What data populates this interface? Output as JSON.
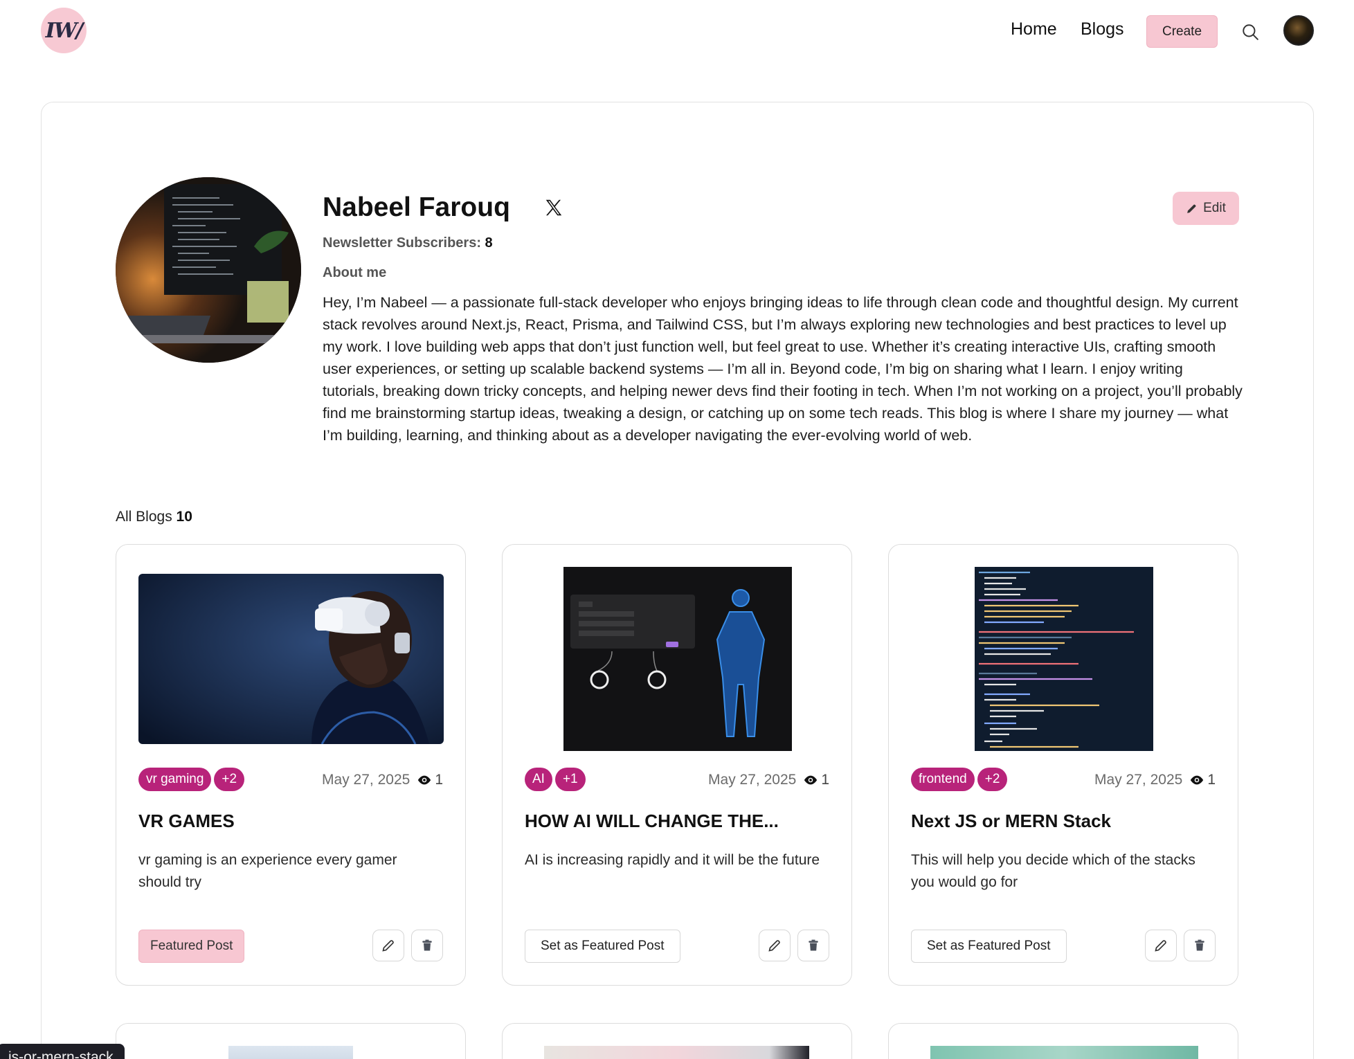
{
  "nav": {
    "logo_text": "IW/",
    "links": [
      "Home",
      "Blogs"
    ],
    "create_label": "Create"
  },
  "profile": {
    "name": "Nabeel Farouq",
    "subscribers_label": "Newsletter Subscribers:",
    "subscribers_count": "8",
    "about_label": "About me",
    "about_text": "Hey, I’m Nabeel — a passionate full-stack developer who enjoys bringing ideas to life through clean code and thoughtful design. My current stack revolves around Next.js, React, Prisma, and Tailwind CSS, but I’m always exploring new technologies and best practices to level up my work. I love building web apps that don’t just function well, but feel great to use. Whether it’s creating interactive UIs, crafting smooth user experiences, or setting up scalable backend systems — I’m all in. Beyond code, I’m big on sharing what I learn. I enjoy writing tutorials, breaking down tricky concepts, and helping newer devs find their footing in tech. When I’m not working on a project, you’ll probably find me brainstorming startup ideas, tweaking a design, or catching up on some tech reads. This blog is where I share my journey — what I’m building, learning, and thinking about as a developer navigating the ever-evolving world of web.",
    "edit_label": "Edit"
  },
  "blogs": {
    "label": "All Blogs",
    "count": "10",
    "cards": [
      {
        "tag": "vr gaming",
        "tag_more": "+2",
        "date": "May 27, 2025",
        "views": "1",
        "title": "VR GAMES",
        "description": "vr gaming is an experience every gamer should try",
        "featured_label": "Featured Post"
      },
      {
        "tag": "AI",
        "tag_more": "+1",
        "date": "May 27, 2025",
        "views": "1",
        "title": "HOW AI WILL CHANGE THE...",
        "description": "AI is increasing rapidly and it will be the future",
        "featured_label": "Set as Featured Post"
      },
      {
        "tag": "frontend",
        "tag_more": "+2",
        "date": "May 27, 2025",
        "views": "1",
        "title": "Next JS or MERN Stack",
        "description": "This will help you decide which of the stacks you would go for",
        "featured_label": "Set as Featured Post"
      }
    ]
  },
  "tooltip": "js-or-mern-stack",
  "colors": {
    "accent_pink": "#f7c7d2",
    "tag_magenta": "#b8237a"
  }
}
